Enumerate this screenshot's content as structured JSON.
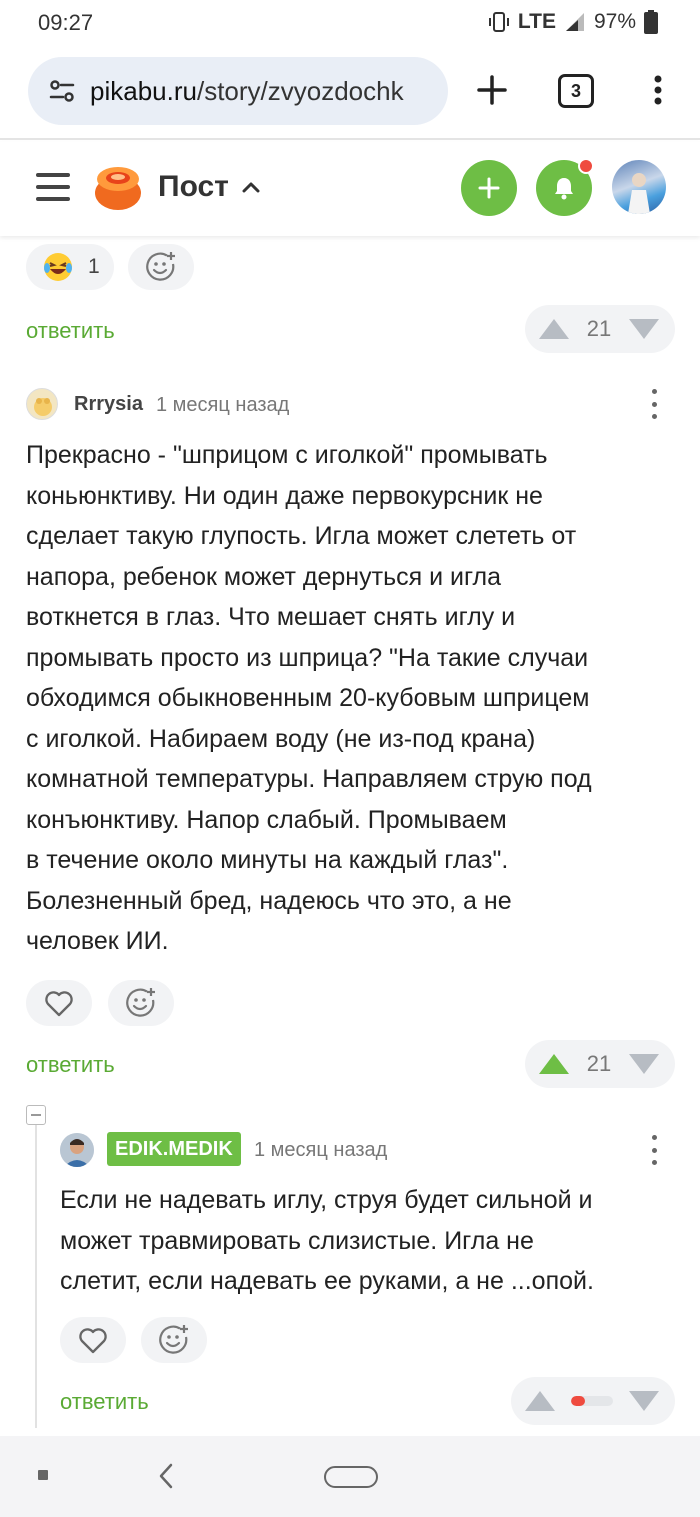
{
  "status_bar": {
    "time": "09:27",
    "network": "LTE",
    "battery": "97%"
  },
  "browser": {
    "url_domain": "pikabu.ru",
    "url_path": "/story/zvyozdochk",
    "tab_count": "3"
  },
  "header": {
    "title": "Пост"
  },
  "top_comment": {
    "reaction_count": "1",
    "reply_label": "ответить",
    "rating": "21"
  },
  "comment1": {
    "author": "Rrrysia",
    "time": "1 месяц назад",
    "body_lines": [
      "Прекрасно - \"шприцом с иголкой\" промывать",
      "коньюнктиву. Ни один даже первокурсник не",
      "сделает такую глупость. Игла может слететь от",
      "напора, ребенок может дернуться и игла",
      "воткнется в глаз. Что мешает снять иглу и",
      "промывать просто из шприца? \"На такие случаи",
      "обходимся обыкновенным 20-кубовым шприцем",
      "с иголкой. Набираем воду (не из-под крана)",
      "комнатной температуры. Направляем струю под",
      "конъюнктиву. Напор слабый. Промываем",
      "в течение около минуты на каждый глаз\".",
      "Болезненный бред, надеюсь что это, а не",
      "человек ИИ."
    ],
    "reply_label": "ответить",
    "rating": "21"
  },
  "comment2": {
    "author": "EDIK.MEDIK",
    "time": "1 месяц назад",
    "body_lines": [
      "Если не надевать иглу, струя будет сильной и",
      "может травмировать слизистые. Игла не",
      "слетит, если надевать ее руками, а не ...опой."
    ],
    "reply_label": "ответить"
  },
  "colors": {
    "accent_green": "#6ebe45",
    "link_green": "#5aaa34",
    "notification_red": "#ef4b3f"
  }
}
